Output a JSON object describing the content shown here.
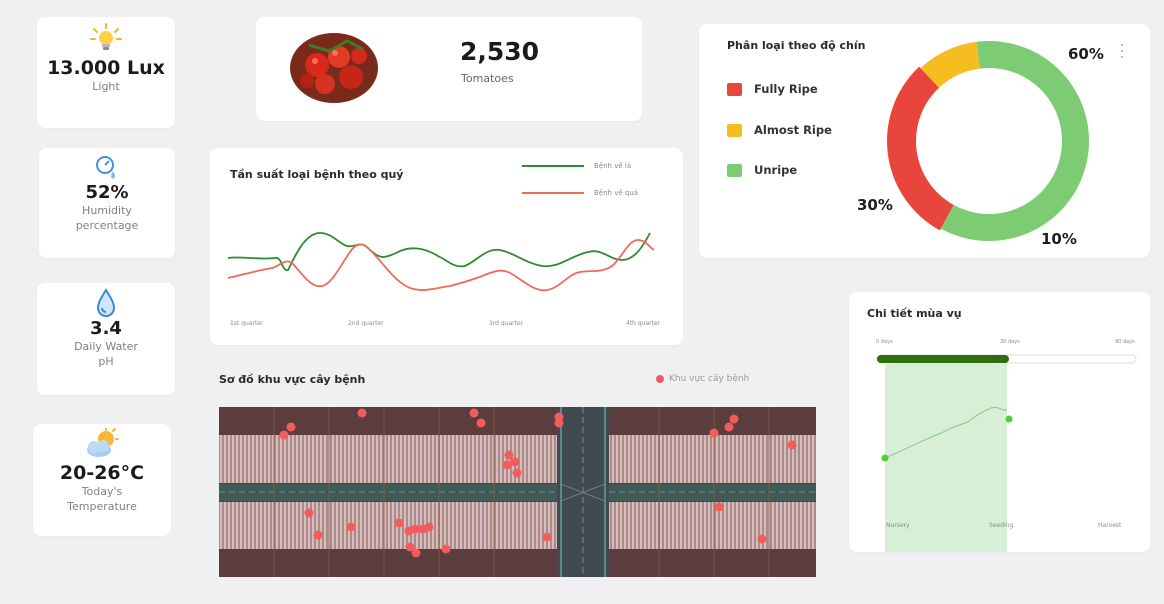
{
  "stats": {
    "light": {
      "value": "13.000 Lux",
      "label": "Light"
    },
    "humidity": {
      "value": "52%",
      "label": "Humidity percentage"
    },
    "water": {
      "value": "3.4",
      "label": "Daily Water pH"
    },
    "temperature": {
      "value": "20-26°C",
      "label": "Today's Temperature"
    }
  },
  "tomatoes": {
    "count": "2,530",
    "label": "Tomatoes"
  },
  "ripeness": {
    "title": "Phân loại theo độ chín",
    "legend": [
      "Fully Ripe",
      "Almost Ripe",
      "Unripe"
    ],
    "percent_labels": [
      "60%",
      "30%",
      "10%"
    ],
    "menu_icon": "kebab-icon"
  },
  "disease_chart": {
    "title": "Tần suất loại bệnh theo quý",
    "legend": [
      "Bệnh về lá",
      "Bệnh về quả"
    ],
    "quarters": [
      "1st quarter",
      "2nd quarter",
      "3rd quarter",
      "4th quarter"
    ]
  },
  "disease_map": {
    "title": "Sơ đồ khu vực cây bệnh",
    "legend": "Khu vực cây bệnh"
  },
  "season": {
    "title": "Chi tiết mùa vụ",
    "top_labels": [
      "0 days",
      "30 days",
      "90 days"
    ],
    "stages": [
      "Nursery",
      "Seeding",
      "Harvest"
    ]
  },
  "colors": {
    "red": "#e8453c",
    "yellow": "#f5bd1f",
    "green": "#7dcb72",
    "leaf_line": "#2e8b2e",
    "fruit_line": "#f06a5a",
    "dot": "#f25c5c",
    "dark_green": "#2f6e0f"
  },
  "chart_data": [
    {
      "type": "pie",
      "title": "Phân loại theo độ chín",
      "categories": [
        "Fully Ripe",
        "Almost Ripe",
        "Unripe"
      ],
      "values": [
        30,
        10,
        60
      ],
      "legend": "left"
    },
    {
      "type": "line",
      "title": "Tần suất loại bệnh theo quý",
      "x": [
        "1st quarter",
        "2nd quarter",
        "3rd quarter",
        "4th quarter"
      ],
      "series": [
        {
          "name": "Bệnh về lá",
          "values": [
            3.2,
            4.8,
            3.6,
            5.8
          ]
        },
        {
          "name": "Bệnh về quả",
          "values": [
            3.0,
            3.6,
            2.5,
            4.4
          ]
        }
      ],
      "legend": "top-right"
    }
  ]
}
